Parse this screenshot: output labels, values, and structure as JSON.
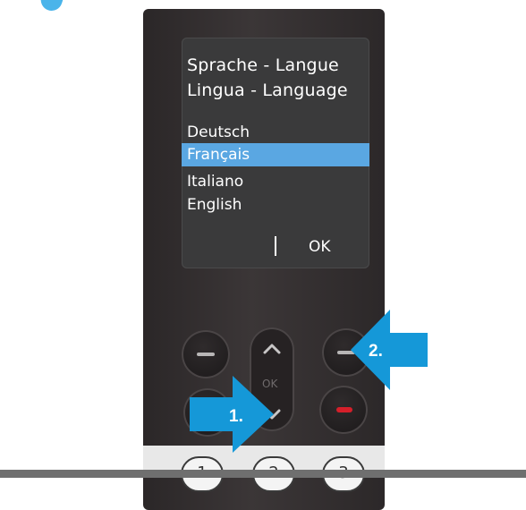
{
  "screen": {
    "title_line1": "Sprache - Langue",
    "title_line2": "Lingua - Language",
    "languages": [
      "Deutsch",
      "Français",
      "Italiano",
      "English"
    ],
    "selected_index": 1,
    "softkey_right": "OK"
  },
  "nav": {
    "center_label": "OK"
  },
  "keypad": {
    "keys": [
      "1",
      "2",
      "3"
    ]
  },
  "annotations": {
    "arrow1": "1.",
    "arrow2": "2."
  },
  "colors": {
    "highlight": "#5aa7e2",
    "annotation_arrow": "#1598d8",
    "end_call": "#d51f2a"
  }
}
